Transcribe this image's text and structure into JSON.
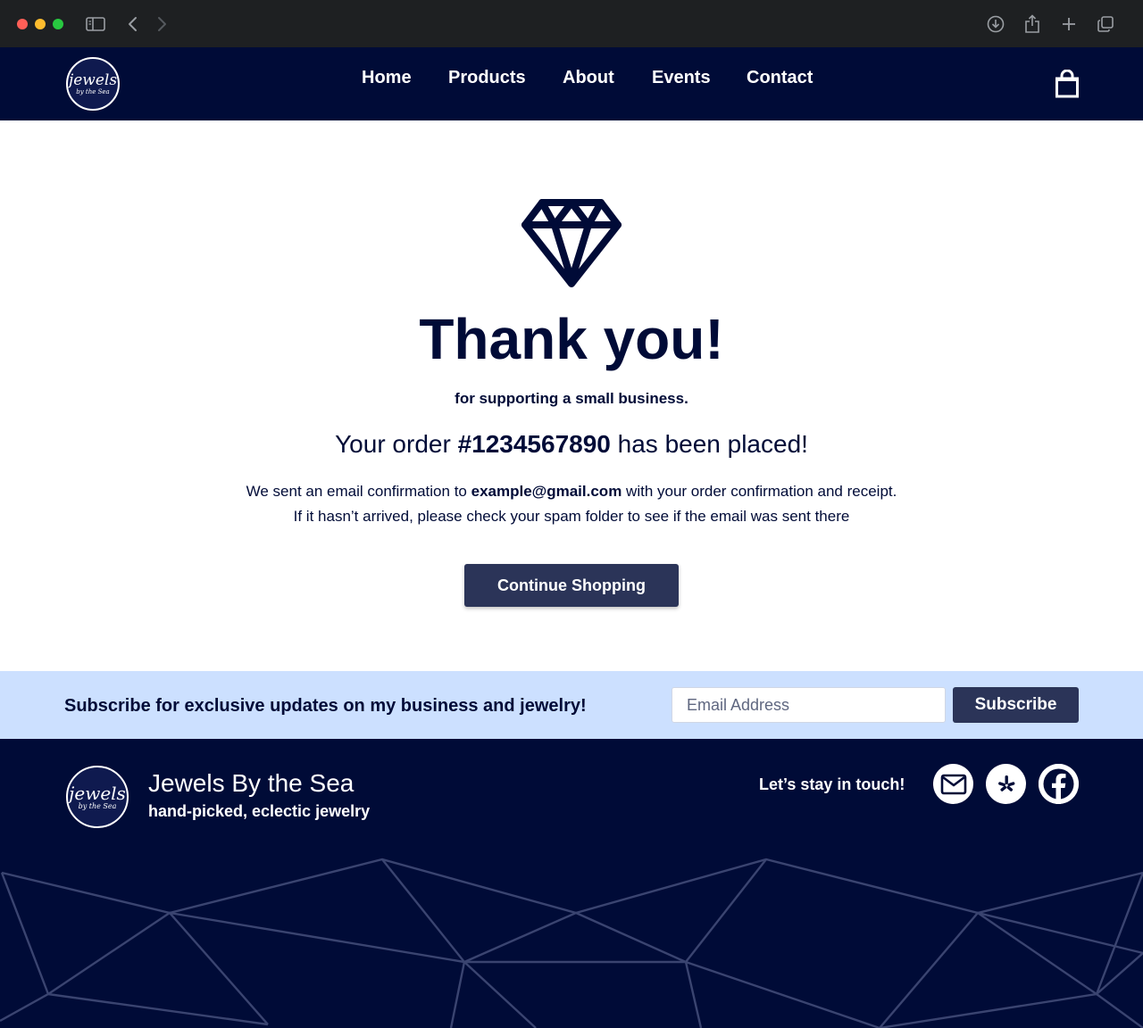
{
  "browser": {
    "icons": [
      "sidebar-icon",
      "back-icon",
      "forward-icon",
      "download-icon",
      "share-icon",
      "new-tab-icon",
      "tabs-icon"
    ]
  },
  "header": {
    "logo": {
      "script": "jewels",
      "sub": "by the Sea"
    },
    "nav": [
      {
        "label": "Home"
      },
      {
        "label": "Products"
      },
      {
        "label": "About"
      },
      {
        "label": "Events"
      },
      {
        "label": "Contact"
      }
    ],
    "cart_icon": "shopping-bag-icon"
  },
  "main": {
    "icon": "diamond-icon",
    "title": "Thank you!",
    "subtitle": "for supporting a small business.",
    "order_prefix": "Your order ",
    "order_number": "#1234567890",
    "order_suffix": " has been placed!",
    "email_prefix": "We sent an email confirmation to ",
    "email_address": "example@gmail.com",
    "email_suffix": " with your order confirmation and receipt.",
    "spam_note": "If it hasn’t arrived, please check your spam folder to see if the email was sent there",
    "continue_label": "Continue Shopping"
  },
  "subscribe": {
    "text": "Subscribe for exclusive updates on my business and jewelry!",
    "placeholder": "Email Address",
    "button_label": "Subscribe"
  },
  "footer": {
    "logo": {
      "script": "jewels",
      "sub": "by the Sea"
    },
    "brand_name": "Jewels By the Sea",
    "tagline": "hand-picked, eclectic jewelry",
    "touch_label": "Let’s stay in touch!",
    "social": [
      "mail-icon",
      "yelp-icon",
      "facebook-icon"
    ]
  },
  "colors": {
    "navy": "#000b37",
    "button": "#2b3458",
    "subscribe_band": "#cce0ff"
  }
}
